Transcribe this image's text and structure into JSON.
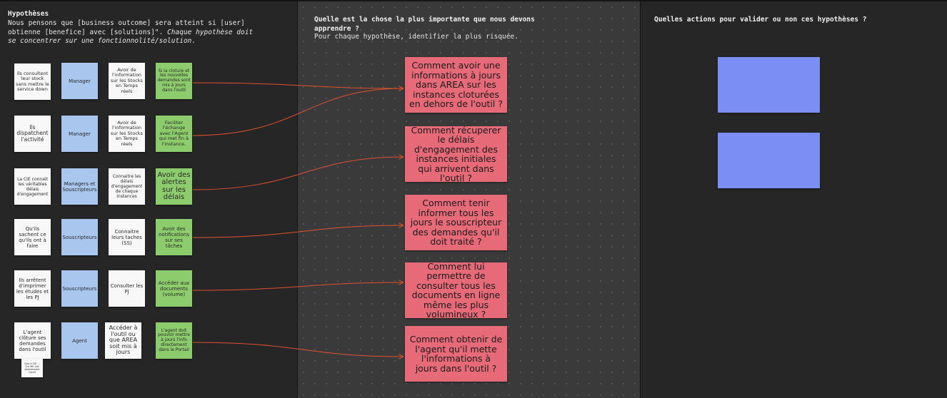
{
  "col1": {
    "title": "Hypothèses",
    "line1": "Nous pensons que [business outcome] sera atteint si [user]",
    "line2_plain": "obtienne [benefice] avec [solutions]\". ",
    "line2_italic": "Chaque hypothèse doit",
    "line3_italic": "se concentrer sur une fonctionnolité/solution."
  },
  "col2": {
    "title_line1": "Quelle est la chose la plus importante que nous devons",
    "title_line2": "apprendre ?",
    "subtitle": "Pour chaque hypothèse, identifier la plus risquée."
  },
  "col3": {
    "title": "Quelles actions pour valider ou non ces hypothèses ?"
  },
  "rows": [
    {
      "who": "Ils consultent leur stock sans mettre le service down",
      "role": "Manager",
      "need": "Avoir de l'information sur les Stocks en Temps réels",
      "benefit": "Si la cloture et les nouvelles demandes sont mis à jours dans l'outil"
    },
    {
      "who": "Ils dispatchent l'activité",
      "role": "Manager",
      "need": "Avoir de l'information sur les Stocks en Temps réels",
      "benefit": "Faciliter l'échange avec l'Agent qui met fin à l'instance."
    },
    {
      "who": "La CIE connait les véritables délais d'engagement",
      "role": "Managers et Souscripteurs",
      "need": "Connaitre les délais d'engagement de chaque instances",
      "benefit": "Avoir des alertes sur les délais"
    },
    {
      "who": "Qu'ils sachent ce qu'ils ont à faire",
      "role": "Souscripteurs",
      "need": "Connaitre leurs taches (SS)",
      "benefit": "Avoir des notifications sur ses tâches"
    },
    {
      "who": "Ils arrêtent d'imprimer les études et les PJ",
      "role": "Souscripteurs",
      "need": "Consulter les PJ",
      "benefit": "Accéder aux documents (volume)"
    },
    {
      "who": "L'agent clôture ses demandes dans l'outil",
      "role": "Agent",
      "need": "Accéder à l'outil ou que AREA soit mis à jours",
      "benefit": "L'agent doit pouvoir mettre à jours l'info directement dans le Portail"
    }
  ],
  "extra_note": "Que a CIE ... Sur Mh rue directement l'outil",
  "questions": [
    "Comment avoir une informations à jours dans AREA sur les instances cloturées en dehors de l'outil ?",
    "Comment récuperer le délais d'engagement des instances initiales qui arrivent dans l'outil ?",
    "Comment tenir informer tous les jours le souscripteur des demandes qu'il doit traité ?",
    "Comment lui permettre de consulter tous les documents en ligne même les plus volumineux ?",
    "Comment obtenir de l'agent qu'il mette l'informations à jours dans l'outil ?"
  ],
  "colors": {
    "white_note": "#f8f8f8",
    "blue_note": "#a9c6ee",
    "green_note": "#8ccc6c",
    "red_note": "#e76a79",
    "purple_note": "#7b8ef3",
    "connector": "#e0502e"
  }
}
